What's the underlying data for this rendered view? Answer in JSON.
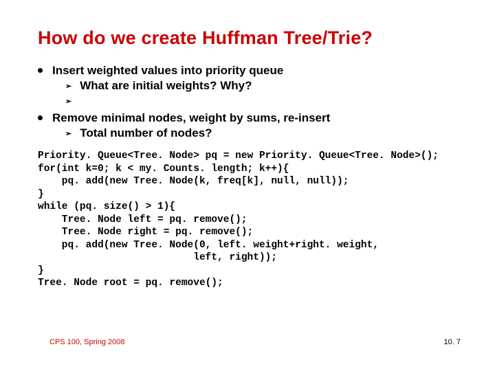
{
  "title": "How do we create Huffman Tree/Trie?",
  "bullets": {
    "b1": "Insert weighted values into priority queue",
    "b1a": "What are initial weights? Why?",
    "b2": "Remove minimal nodes, weight by sums, re-insert",
    "b2a": "Total number of nodes?"
  },
  "code": "Priority. Queue<Tree. Node> pq = new Priority. Queue<Tree. Node>();\nfor(int k=0; k < my. Counts. length; k++){\n    pq. add(new Tree. Node(k, freq[k], null, null));\n}\nwhile (pq. size() > 1){\n    Tree. Node left = pq. remove();\n    Tree. Node right = pq. remove();\n    pq. add(new Tree. Node(0, left. weight+right. weight,\n                          left, right));\n}\nTree. Node root = pq. remove();",
  "footer": {
    "left": "CPS 100, Spring 2008",
    "right": "10. 7"
  }
}
